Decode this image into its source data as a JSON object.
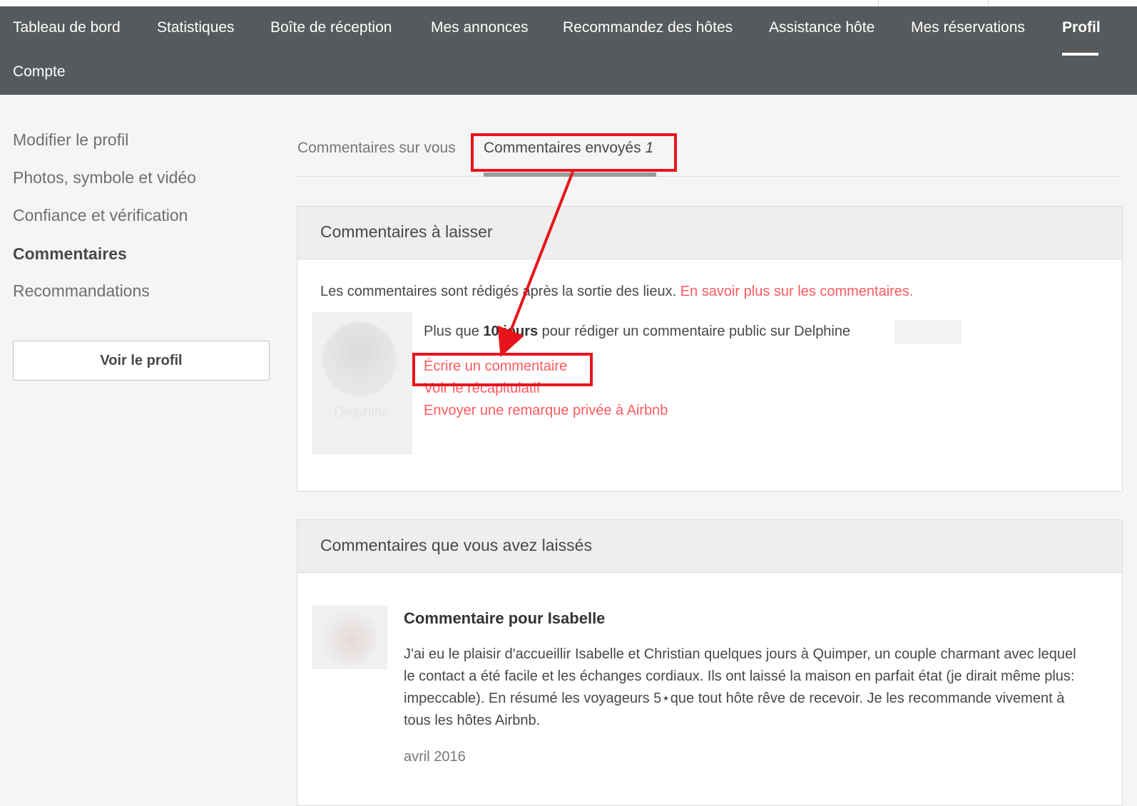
{
  "nav": {
    "items": [
      {
        "label": "Tableau de bord"
      },
      {
        "label": "Statistiques"
      },
      {
        "label": "Boîte de réception"
      },
      {
        "label": "Mes annonces"
      },
      {
        "label": "Recommandez des hôtes"
      },
      {
        "label": "Assistance hôte"
      },
      {
        "label": "Mes réservations"
      },
      {
        "label": "Profil"
      },
      {
        "label": "Compte"
      }
    ],
    "active": "Profil"
  },
  "sidebar": {
    "items": [
      {
        "label": "Modifier le profil"
      },
      {
        "label": "Photos, symbole et vidéo"
      },
      {
        "label": "Confiance et vérification"
      },
      {
        "label": "Commentaires"
      },
      {
        "label": "Recommandations"
      }
    ],
    "active": "Commentaires",
    "view_profile_button": "Voir le profil"
  },
  "tabs": {
    "about_you": "Commentaires sur vous",
    "sent": "Commentaires envoyés",
    "sent_count": "1"
  },
  "pending": {
    "title": "Commentaires à laisser",
    "intro": "Les commentaires sont rédigés après la sortie des lieux.",
    "learn_more": "En savoir plus sur les commentaires.",
    "guest_name": "Delphine",
    "deadline_prefix": "Plus que",
    "deadline_value": "10 jours",
    "deadline_suffix": "pour rédiger un commentaire public sur Delphine",
    "write_review": "Écrire un commentaire",
    "view_summary": "Voir le récapitulatif",
    "private_note": "Envoyer une remarque privée à Airbnb"
  },
  "left_reviews": {
    "title": "Commentaires que vous avez laissés",
    "reviews": [
      {
        "heading": "Commentaire pour Isabelle",
        "text": "J'ai eu le plaisir d'accueillir Isabelle et Christian quelques jours à Quimper, un couple charmant avec lequel le contact a été facile et les échanges cordiaux. Ils ont laissé la maison en parfait état (je dirait même plus: impeccable). En résumé les voyageurs 5⋆que tout hôte rêve de recevoir. Je les recommande vivement à tous les hôtes Airbnb.",
        "date": "avril 2016"
      }
    ]
  },
  "colors": {
    "nav_bg": "#565a5c",
    "accent": "#ff5a5f",
    "annotation": "#e8141c"
  }
}
